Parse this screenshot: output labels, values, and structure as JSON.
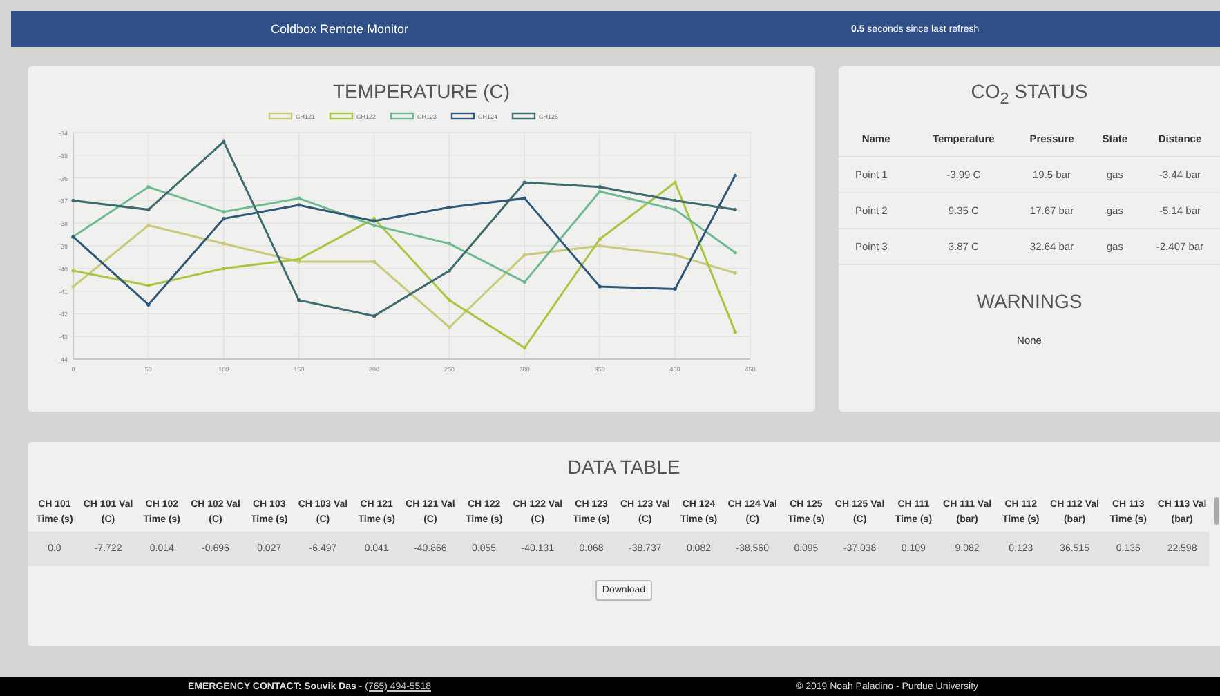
{
  "header": {
    "title": "Coldbox Remote Monitor",
    "refresh": "**0.5** seconds since last refresh"
  },
  "temperature": {
    "title": "TEMPERATURE (C)",
    "chart_data": {
      "type": "line",
      "x": [
        0,
        50,
        100,
        150,
        200,
        250,
        300,
        350,
        400,
        440
      ],
      "series": [
        {
          "name": "CH121",
          "color": "#c9c97a",
          "values": [
            -40.8,
            -38.1,
            -38.9,
            -39.7,
            -39.7,
            -42.6,
            -39.4,
            -39.0,
            -39.4,
            -40.2
          ]
        },
        {
          "name": "CH122",
          "color": "#a9c640",
          "values": [
            -40.1,
            -40.75,
            -40.0,
            -39.6,
            -37.8,
            -41.4,
            -43.5,
            -38.7,
            -36.2,
            -42.8
          ]
        },
        {
          "name": "CH123",
          "color": "#6dbb8f",
          "values": [
            -38.6,
            -36.4,
            -37.5,
            -36.9,
            -38.1,
            -38.9,
            -40.6,
            -36.6,
            -37.4,
            -39.3
          ]
        },
        {
          "name": "CH124",
          "color": "#2f5878",
          "values": [
            -38.6,
            -41.6,
            -37.8,
            -37.2,
            -37.9,
            -37.3,
            -36.9,
            -40.8,
            -40.9,
            -35.9
          ]
        },
        {
          "name": "CH125",
          "color": "#3d6b6e",
          "values": [
            -37.0,
            -37.4,
            -34.4,
            -41.4,
            -42.1,
            -40.1,
            -36.2,
            -36.4,
            -37.0,
            -37.4
          ]
        }
      ],
      "grid": true,
      "legend": true,
      "xlim": [
        0,
        450
      ],
      "ylim": [
        -44,
        -34
      ],
      "xticks": [
        0,
        50,
        100,
        150,
        200,
        250,
        300,
        350,
        400,
        450
      ],
      "yticks": [
        -34,
        -35,
        -36,
        -37,
        -38,
        -39,
        -40,
        -41,
        -42,
        -43,
        -44
      ]
    }
  },
  "co2_status": {
    "title": "CO$_{2}$ STATUS",
    "columns": [
      "Name",
      "Temperature",
      "Pressure",
      "State",
      "Distance"
    ],
    "rows": [
      [
        "Point 1",
        "-3.99 C",
        "19.5 bar",
        "gas",
        "-3.44 bar"
      ],
      [
        "Point 2",
        "9.35 C",
        "17.67 bar",
        "gas",
        "-5.14 bar"
      ],
      [
        "Point 3",
        "3.87 C",
        "32.64 bar",
        "gas",
        "-2.407 bar"
      ]
    ]
  },
  "warnings": {
    "title": "WARNINGS",
    "message": "None"
  },
  "data_table": {
    "title": "DATA TABLE",
    "columns": [
      "CH 101 Time (s)",
      "CH 101 Val (C)",
      "CH 102 Time (s)",
      "CH 102 Val (C)",
      "CH 103 Time (s)",
      "CH 103 Val (C)",
      "CH 121 Time (s)",
      "CH 121 Val (C)",
      "CH 122 Time (s)",
      "CH 122 Val (C)",
      "CH 123 Time (s)",
      "CH 123 Val (C)",
      "CH 124 Time (s)",
      "CH 124 Val (C)",
      "CH 125 Time (s)",
      "CH 125 Val (C)",
      "CH 111 Time (s)",
      "CH 111 Val (bar)",
      "CH 112 Time (s)",
      "CH 112 Val (bar)",
      "CH 113 Time (s)",
      "CH 113 Val (bar)"
    ],
    "rows": [
      [
        "0.0",
        "-7.722",
        "0.014",
        "-0.696",
        "0.027",
        "-6.497",
        "0.041",
        "-40.866",
        "0.055",
        "-40.131",
        "0.068",
        "-38.737",
        "0.082",
        "-38.560",
        "0.095",
        "-37.038",
        "0.109",
        "9.082",
        "0.123",
        "36.515",
        "0.136",
        "22.598"
      ]
    ],
    "download_button": "Download"
  },
  "footer": {
    "contact": "**EMERGENCY CONTACT: Souvik Das** - ",
    "phone": "(765) 494-5518",
    "copyright": "© 2019 Noah Paladino - Purdue University"
  }
}
